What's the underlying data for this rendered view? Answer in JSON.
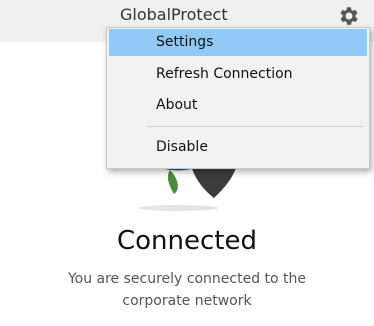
{
  "app": {
    "title": "GlobalProtect"
  },
  "menu": {
    "items": [
      {
        "label": "Settings",
        "highlighted": true
      },
      {
        "label": "Refresh Connection"
      },
      {
        "label": "About"
      },
      {
        "label": "Disable"
      }
    ]
  },
  "status": {
    "title": "Connected",
    "description_line1": "You are securely connected to the",
    "description_line2": "corporate network"
  },
  "colors": {
    "menu_highlight": "#91c9f7",
    "globe_ocean": "#1f5d94",
    "globe_land": "#4a8a3a",
    "shield": "#3c3c3c"
  }
}
